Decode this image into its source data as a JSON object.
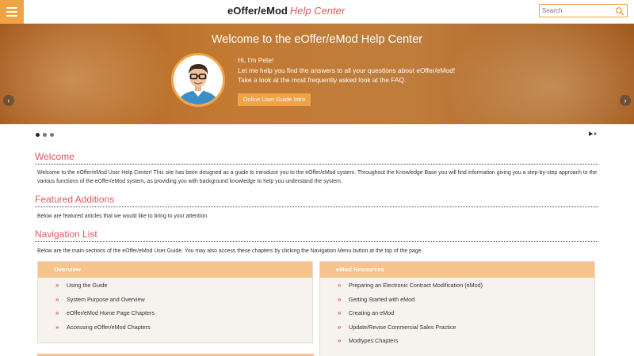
{
  "header": {
    "logo_main": "eOffer/eMod",
    "logo_sub": "Help Center",
    "search_placeholder": "Search"
  },
  "banner": {
    "title": "Welcome to the eOffer/eMod Help Center",
    "greeting": "Hi, I'm Pete!",
    "line1": "Let me help you find the answers to all your questions about eOffer/eMod!",
    "line2": "Take a look at the most frequently asked look at the FAQ.",
    "button": "Online User Guide Intro",
    "prev_arrow": "‹",
    "next_arrow": "›"
  },
  "carousel": {
    "dots": 3,
    "active_dot": 0,
    "play_pause": "▶⏸"
  },
  "welcome": {
    "title": "Welcome",
    "text": "Welcome to the eOffer/eMod User Help Center! This site has been designed as a guide to introduce you to the eOffer/eMod system. Throughout the Knowledge Base you will find information giving you a step-by-step approach to the various functions of the eOffer/eMod system, as providing you with background knowledge to help you understand the system."
  },
  "featured": {
    "title": "Featured Additions",
    "text": "Below are featured articles that we would like to bring to your attention."
  },
  "navigation": {
    "title": "Navigation List",
    "text": "Below are the main sections of the eOffer/eMod User Guide. You may also access these chapters by clicking the Navigation Menu button at the top of the page."
  },
  "panels": [
    {
      "title": "Overview",
      "items": [
        "Using the Guide",
        "System Purpose and Overview",
        "eOffer/eMod Home Page Chapters",
        "Accessing eOffer/eMod Chapters"
      ]
    },
    {
      "title": "eMod Resources",
      "items": [
        "Preparing an Electronic Contract Modification (eMod)",
        "Getting Started with eMod",
        "Creating an eMod",
        "Update/Revise Commercial Sales Practice",
        "Modtypes Chapters"
      ]
    }
  ],
  "bullet": "»",
  "colors": {
    "accent_orange": "#f1a245",
    "heading_red": "#e0585d",
    "panel_header": "#f6c48c",
    "panel_bg": "#f6f2ee"
  },
  "icons": [
    "menu-icon",
    "search-icon",
    "chevron-left-icon",
    "chevron-right-icon",
    "play-pause-icon",
    "bullet-icon"
  ]
}
